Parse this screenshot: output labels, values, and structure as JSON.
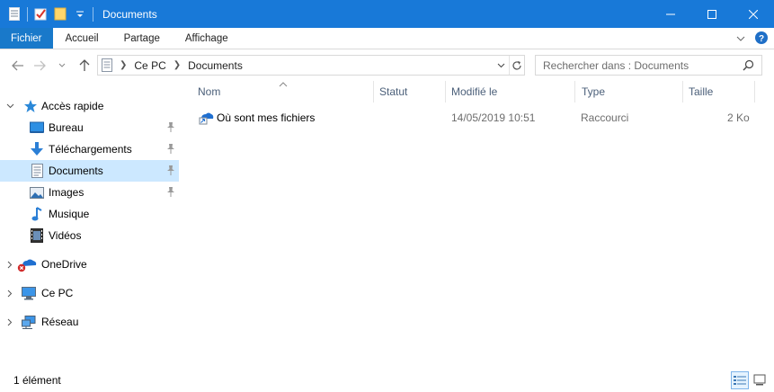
{
  "window": {
    "title": "Documents"
  },
  "colors": {
    "titlebar": "#1879d8",
    "file_tab": "#1979ca",
    "selection": "#cce8ff"
  },
  "ribbon": {
    "tabs": [
      "Fichier",
      "Accueil",
      "Partage",
      "Affichage"
    ]
  },
  "address": {
    "crumbs": [
      "Ce PC",
      "Documents"
    ]
  },
  "search": {
    "placeholder": "Rechercher dans : Documents"
  },
  "navpane": {
    "quick_access": "Accès rapide",
    "items": [
      {
        "label": "Bureau",
        "icon": "desktop-icon",
        "pinned": true
      },
      {
        "label": "Téléchargements",
        "icon": "downloads-icon",
        "pinned": true
      },
      {
        "label": "Documents",
        "icon": "documents-icon",
        "pinned": true,
        "selected": true
      },
      {
        "label": "Images",
        "icon": "pictures-icon",
        "pinned": true
      },
      {
        "label": "Musique",
        "icon": "music-icon",
        "pinned": false
      },
      {
        "label": "Vidéos",
        "icon": "videos-icon",
        "pinned": false
      }
    ],
    "onedrive": "OneDrive",
    "thispc": "Ce PC",
    "network": "Réseau"
  },
  "columns": [
    "Nom",
    "Statut",
    "Modifié le",
    "Type",
    "Taille"
  ],
  "files": [
    {
      "name": "Où sont mes fichiers",
      "status": "",
      "modified": "14/05/2019 10:51",
      "type": "Raccourci",
      "size": "2 Ko"
    }
  ],
  "status": {
    "count": "1 élément"
  }
}
